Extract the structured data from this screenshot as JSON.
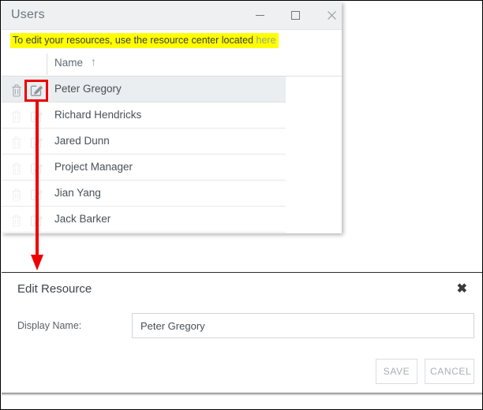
{
  "window": {
    "title": "Users",
    "controls": [
      {
        "name": "minimize",
        "glyph": "—"
      },
      {
        "name": "maximize",
        "glyph": "□"
      },
      {
        "name": "close",
        "glyph": "×"
      }
    ]
  },
  "banner": {
    "text_before": "To edit your resources, use the resource center located ",
    "link_text": "here",
    "background": "#ffff00",
    "text_color": "#3c3c3c",
    "link_color": "#9aa87a"
  },
  "table": {
    "column_header": "Name",
    "sort_indicator": "↑",
    "sort_direction": "ascending",
    "rows": [
      {
        "name": "Peter Gregory",
        "selected": true
      },
      {
        "name": "Richard Hendricks",
        "selected": false
      },
      {
        "name": "Jared Dunn",
        "selected": false
      },
      {
        "name": "Project Manager",
        "selected": false
      },
      {
        "name": "Jian Yang",
        "selected": false
      },
      {
        "name": "Jack Barker",
        "selected": false
      }
    ],
    "row_icons": {
      "delete": "trash-icon",
      "edit": "edit-pencil-icon"
    },
    "selected_row_background": "#eaeef1"
  },
  "annotation": {
    "highlight_color": "#ee0000",
    "highlight_target": "edit-pencil-icon of Peter Gregory row",
    "arrow_color": "#ee0000",
    "arrow_direction": "down"
  },
  "dialog": {
    "title": "Edit Resource",
    "close_glyph": "✖",
    "field_label": "Display Name:",
    "field_value": "Peter Gregory",
    "field_placeholder": "",
    "save_label": "SAVE",
    "cancel_label": "CANCEL",
    "button_text_color": "#a9aeb3"
  }
}
